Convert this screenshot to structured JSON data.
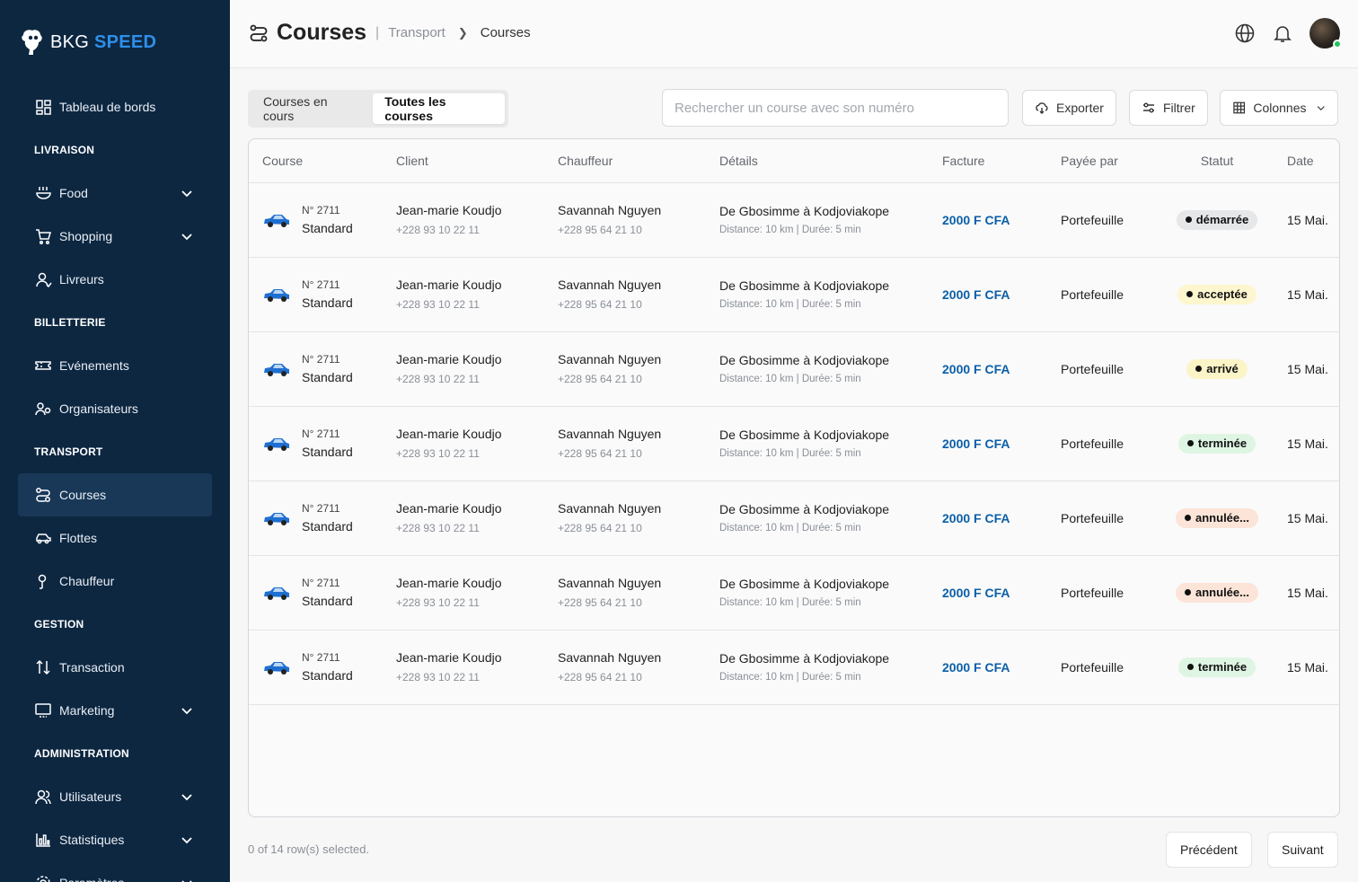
{
  "brand": {
    "name_part1": "BKG",
    "name_part2": "SPEED"
  },
  "sidebar": {
    "items": [
      {
        "kind": "item",
        "label": "Tableau de bords",
        "icon": "dashboard-icon",
        "chevron": false
      },
      {
        "kind": "section",
        "label": "LIVRAISON"
      },
      {
        "kind": "item",
        "label": "Food",
        "icon": "food-icon",
        "chevron": true
      },
      {
        "kind": "item",
        "label": "Shopping",
        "icon": "cart-icon",
        "chevron": true
      },
      {
        "kind": "item",
        "label": "Livreurs",
        "icon": "user-icon",
        "chevron": false
      },
      {
        "kind": "section",
        "label": "BILLETTERIE"
      },
      {
        "kind": "item",
        "label": "Evénements",
        "icon": "ticket-icon",
        "chevron": false
      },
      {
        "kind": "item",
        "label": "Organisateurs",
        "icon": "users-icon",
        "chevron": false
      },
      {
        "kind": "section",
        "label": "TRANSPORT"
      },
      {
        "kind": "item",
        "label": "Courses",
        "icon": "route-icon",
        "chevron": false,
        "active": true
      },
      {
        "kind": "item",
        "label": "Flottes",
        "icon": "car-icon",
        "chevron": false
      },
      {
        "kind": "item",
        "label": "Chauffeur",
        "icon": "driver-icon",
        "chevron": false
      },
      {
        "kind": "section",
        "label": "GESTION"
      },
      {
        "kind": "item",
        "label": "Transaction",
        "icon": "transfer-icon",
        "chevron": false
      },
      {
        "kind": "item",
        "label": "Marketing",
        "icon": "monitor-icon",
        "chevron": true
      },
      {
        "kind": "section",
        "label": "ADMINISTRATION"
      },
      {
        "kind": "item",
        "label": "Utilisateurs",
        "icon": "user-group-icon",
        "chevron": true
      },
      {
        "kind": "item",
        "label": "Statistiques",
        "icon": "chart-icon",
        "chevron": true
      },
      {
        "kind": "item",
        "label": "Paramètres",
        "icon": "settings-icon",
        "chevron": true
      }
    ]
  },
  "header": {
    "title": "Courses",
    "breadcrumb": [
      "Transport",
      "Courses"
    ]
  },
  "toolbar": {
    "tabs": [
      {
        "label": "Courses en cours",
        "active": false
      },
      {
        "label": "Toutes les courses",
        "active": true
      }
    ],
    "search_placeholder": "Rechercher un course avec son numéro",
    "export_label": "Exporter",
    "filter_label": "Filtrer",
    "columns_label": "Colonnes"
  },
  "table": {
    "columns": [
      "Course",
      "Client",
      "Chauffeur",
      "Détails",
      "Facture",
      "Payée par",
      "Statut",
      "Date"
    ],
    "rows": [
      {
        "num": "N° 2711",
        "type": "Standard",
        "client": "Jean-marie Koudjo",
        "client_phone": "+228 93 10 22 11",
        "driver": "Savannah Nguyen",
        "driver_phone": "+228 95 64 21 10",
        "route": "De Gbosimme à Kodjoviakope",
        "meta": "Distance: 10 km | Durée: 5 min",
        "invoice": "2000 F CFA",
        "paid_by": "Portefeuille",
        "status": "démarrée",
        "status_class": "b-started",
        "date": "15 Mai."
      },
      {
        "num": "N° 2711",
        "type": "Standard",
        "client": "Jean-marie Koudjo",
        "client_phone": "+228 93 10 22 11",
        "driver": "Savannah Nguyen",
        "driver_phone": "+228 95 64 21 10",
        "route": "De Gbosimme à Kodjoviakope",
        "meta": "Distance: 10 km | Durée: 5 min",
        "invoice": "2000 F CFA",
        "paid_by": "Portefeuille",
        "status": "acceptée",
        "status_class": "b-accepted",
        "date": "15 Mai."
      },
      {
        "num": "N° 2711",
        "type": "Standard",
        "client": "Jean-marie Koudjo",
        "client_phone": "+228 93 10 22 11",
        "driver": "Savannah Nguyen",
        "driver_phone": "+228 95 64 21 10",
        "route": "De Gbosimme à Kodjoviakope",
        "meta": "Distance: 10 km | Durée: 5 min",
        "invoice": "2000 F CFA",
        "paid_by": "Portefeuille",
        "status": "arrivé",
        "status_class": "b-arrived",
        "date": "15 Mai."
      },
      {
        "num": "N° 2711",
        "type": "Standard",
        "client": "Jean-marie Koudjo",
        "client_phone": "+228 93 10 22 11",
        "driver": "Savannah Nguyen",
        "driver_phone": "+228 95 64 21 10",
        "route": "De Gbosimme à Kodjoviakope",
        "meta": "Distance: 10 km | Durée: 5 min",
        "invoice": "2000 F CFA",
        "paid_by": "Portefeuille",
        "status": "terminée",
        "status_class": "b-done",
        "date": "15 Mai."
      },
      {
        "num": "N° 2711",
        "type": "Standard",
        "client": "Jean-marie Koudjo",
        "client_phone": "+228 93 10 22 11",
        "driver": "Savannah Nguyen",
        "driver_phone": "+228 95 64 21 10",
        "route": "De Gbosimme à Kodjoviakope",
        "meta": "Distance: 10 km | Durée: 5 min",
        "invoice": "2000 F CFA",
        "paid_by": "Portefeuille",
        "status": "annulée...",
        "status_class": "b-cancel",
        "date": "15 Mai."
      },
      {
        "num": "N° 2711",
        "type": "Standard",
        "client": "Jean-marie Koudjo",
        "client_phone": "+228 93 10 22 11",
        "driver": "Savannah Nguyen",
        "driver_phone": "+228 95 64 21 10",
        "route": "De Gbosimme à Kodjoviakope",
        "meta": "Distance: 10 km | Durée: 5 min",
        "invoice": "2000 F CFA",
        "paid_by": "Portefeuille",
        "status": "annulée...",
        "status_class": "b-cancel",
        "date": "15 Mai."
      },
      {
        "num": "N° 2711",
        "type": "Standard",
        "client": "Jean-marie Koudjo",
        "client_phone": "+228 93 10 22 11",
        "driver": "Savannah Nguyen",
        "driver_phone": "+228 95 64 21 10",
        "route": "De Gbosimme à Kodjoviakope",
        "meta": "Distance: 10 km | Durée: 5 min",
        "invoice": "2000 F CFA",
        "paid_by": "Portefeuille",
        "status": "terminée",
        "status_class": "b-done",
        "date": "15 Mai."
      }
    ]
  },
  "footer": {
    "selection_text": "0 of 14 row(s) selected.",
    "prev_label": "Précédent",
    "next_label": "Suivant"
  },
  "colors": {
    "sidebar_bg": "#0d2741",
    "sidebar_active": "#193858",
    "brand_accent": "#2f8fe8",
    "invoice": "#0b5fa8",
    "online": "#22c55e"
  }
}
